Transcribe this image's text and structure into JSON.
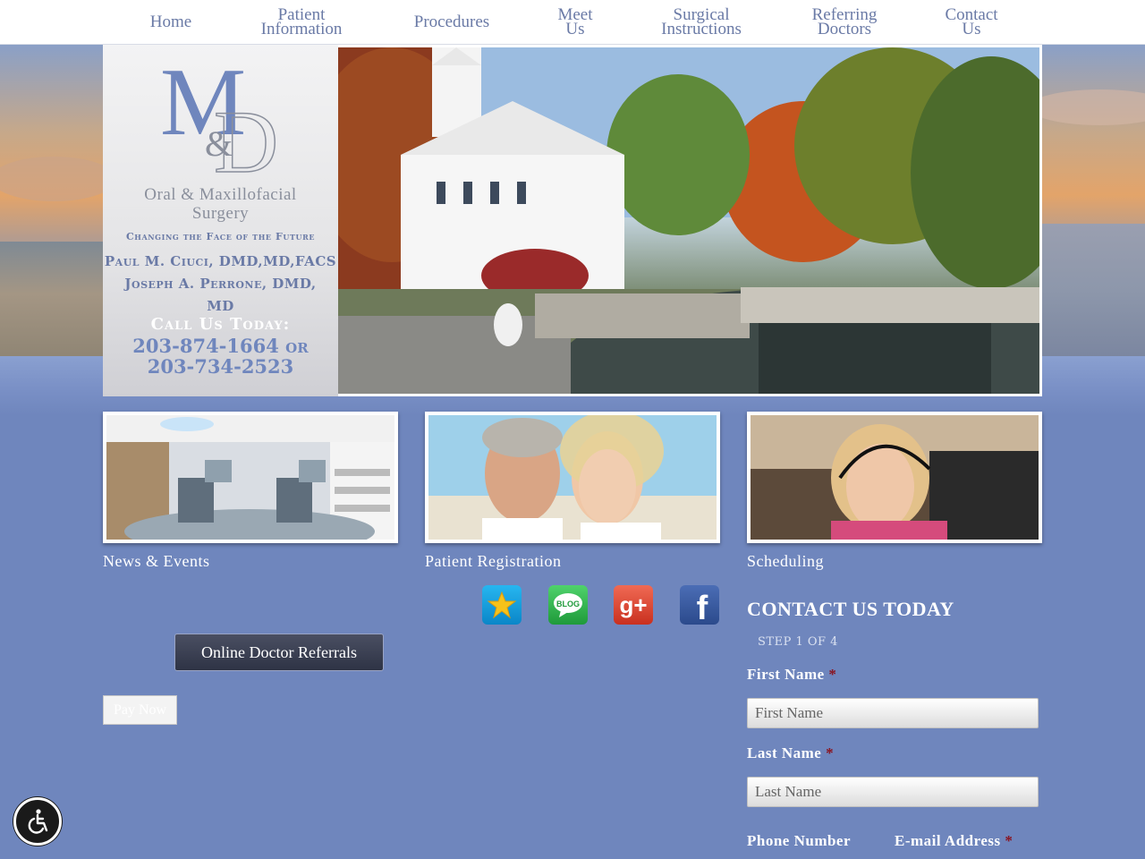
{
  "nav": {
    "items": [
      {
        "line1": "Home",
        "line2": ""
      },
      {
        "line1": "Patient",
        "line2": "Information"
      },
      {
        "line1": "Procedures",
        "line2": ""
      },
      {
        "line1": "Meet",
        "line2": "Us"
      },
      {
        "line1": "Surgical",
        "line2": "Instructions"
      },
      {
        "line1": "Referring",
        "line2": "Doctors"
      },
      {
        "line1": "Contact",
        "line2": "Us"
      }
    ]
  },
  "logo": {
    "monogram_m": "M",
    "monogram_amp": "&",
    "monogram_d": "D",
    "name_line1": "Oral & Maxillofacial",
    "name_line2": "Surgery",
    "tagline": "Changing the Face of the Future",
    "doctor1": "Paul M. Ciuci, DMD,MD,FACS",
    "doctor2": "Joseph A. Perrone, DMD,",
    "doctor2_suffix": "MD",
    "call_title": "Call Us Today:",
    "phone_line1": "203-874-1664 or",
    "phone_line2": "203-734-2523"
  },
  "cards": [
    {
      "label": "News & Events"
    },
    {
      "label": "Patient Registration"
    },
    {
      "label": "Scheduling"
    }
  ],
  "social": [
    {
      "icon": "star-review-icon"
    },
    {
      "icon": "blog-icon",
      "text": "BLOG"
    },
    {
      "icon": "google-plus-icon",
      "text": "g+"
    },
    {
      "icon": "facebook-icon",
      "text": "f"
    }
  ],
  "buttons": {
    "referral": "Online Doctor Referrals",
    "pay_now": "Pay Now"
  },
  "form": {
    "title": "CONTACT US TODAY",
    "step": "STEP 1 OF 4",
    "first_name_label": "First Name",
    "first_name_placeholder": "First Name",
    "last_name_label": "Last Name",
    "last_name_placeholder": "Last Name",
    "phone_label": "Phone Number",
    "email_label": "E-mail Address",
    "required_mark": "*"
  },
  "colors": {
    "page_bg": "#6f86bd",
    "nav_text": "#6a7aa6",
    "required": "#8a1420",
    "button_dark": "#2e3345"
  }
}
